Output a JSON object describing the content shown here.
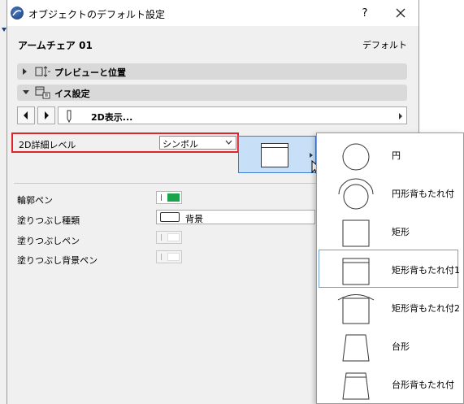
{
  "window": {
    "title": "オブジェクトのデフォルト設定",
    "help_label": "?",
    "close_icon": "close-icon"
  },
  "header": {
    "name": "アームチェア 01",
    "default_label": "デフォルト"
  },
  "sections": [
    {
      "label": "プレビューと位置",
      "expanded": false
    },
    {
      "label": "イス設定",
      "expanded": true
    }
  ],
  "nav": {
    "prev_icon": "arrow-left-icon",
    "next_icon": "arrow-right-icon",
    "label": "2D表示..."
  },
  "detail_level": {
    "label": "2D詳細レベル",
    "value": "シンボル"
  },
  "properties": {
    "contour_pen": "輪郭ペン",
    "fill_type": "塗りつぶし種類",
    "fill_type_value": "背景",
    "fill_pen": "塗りつぶしペン",
    "fill_bg_pen": "塗りつぶし背景ペン"
  },
  "colors": {
    "accent_red": "#e0242b",
    "pen_green": "#1aa34a",
    "selection_blue": "#3c7fd1"
  },
  "popup": {
    "items": [
      {
        "label": "円",
        "shape": "circle",
        "selected": false
      },
      {
        "label": "円形背もたれ付",
        "shape": "circle-with-back",
        "selected": false
      },
      {
        "label": "矩形",
        "shape": "rectangle",
        "selected": false
      },
      {
        "label": "矩形背もたれ付1",
        "shape": "rectangle-with-back-1",
        "selected": true
      },
      {
        "label": "矩形背もたれ付2",
        "shape": "rectangle-with-back-2",
        "selected": false
      },
      {
        "label": "台形",
        "shape": "trapezoid",
        "selected": false
      },
      {
        "label": "台形背もたれ付",
        "shape": "trapezoid-with-back",
        "selected": false
      }
    ]
  }
}
